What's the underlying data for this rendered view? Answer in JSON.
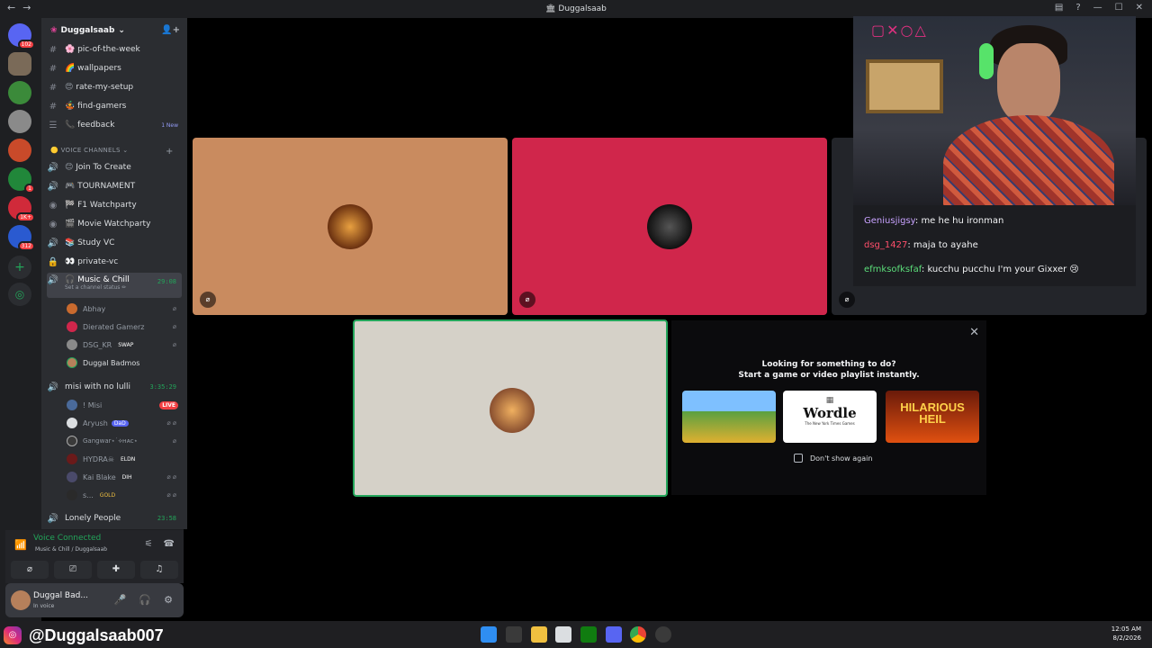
{
  "window": {
    "title": "Duggalsaab"
  },
  "servers": {
    "home_badge": "102",
    "badges": [
      "1",
      "1K+",
      "312"
    ]
  },
  "guild": {
    "name": "Duggalsaab"
  },
  "channels": [
    {
      "name": "pic-of-the-week",
      "emoji": "🌸"
    },
    {
      "name": "wallpapers",
      "emoji": "🌈"
    },
    {
      "name": "rate-my-setup",
      "emoji": "😍"
    },
    {
      "name": "find-gamers",
      "emoji": "🤹"
    },
    {
      "name": "feedback",
      "emoji": "📞",
      "badge": "1 New"
    }
  ],
  "voice_category": {
    "label": "VOICE CHANNELS"
  },
  "voice_channels": [
    {
      "name": "Join To Create",
      "emoji": "😊"
    },
    {
      "name": "TOURNAMENT",
      "emoji": "🎮"
    },
    {
      "name": "F1 Watchparty",
      "emoji": "🏁"
    },
    {
      "name": "Movie Watchparty",
      "emoji": "🎬"
    },
    {
      "name": "Study VC",
      "emoji": "📚"
    },
    {
      "name": "private-vc",
      "emoji": "👀"
    }
  ],
  "active_channel": {
    "name": "Music & Chill",
    "emoji": "🎧",
    "time": "29:08",
    "status": "Set a channel status ✏"
  },
  "active_members": [
    {
      "name": "Abhay"
    },
    {
      "name": "Dierated Gamerz"
    },
    {
      "name": "DSG_KR",
      "tag": "SWAP"
    },
    {
      "name": "Duggal Badmos"
    }
  ],
  "other_channel": {
    "name": "misi with no lulli",
    "time": "3:35:29"
  },
  "other_members": [
    {
      "name": "! Misi",
      "live": "LIVE"
    },
    {
      "name": "Aryush",
      "tag": "DaD"
    },
    {
      "name": "Gangwar⋆˙⟡ʜᴀᴄ⋆"
    },
    {
      "name": "HYDRA☠",
      "tag": "ELDN"
    },
    {
      "name": "Kai Blake",
      "tag": "DIH"
    },
    {
      "name": "s...",
      "tag": "GOLD"
    }
  ],
  "next_channel": {
    "name": "Lonely People",
    "time": "23:58"
  },
  "voice_panel": {
    "status": "Voice Connected",
    "location": "Music & Chill / Duggalsaab"
  },
  "user_panel": {
    "name": "Duggal Bad...",
    "status": "In voice"
  },
  "chat": [
    {
      "user": "Geniusjigsy",
      "text": "me he hu ironman"
    },
    {
      "user": "dsg_1427",
      "text": "maja to ayahe"
    },
    {
      "user": "efmksofksfaf",
      "text": "kucchu pucchu I'm your Gixxer 😢"
    }
  ],
  "activity": {
    "line1": "Looking for something to do?",
    "line2": "Start a game or video playlist instantly.",
    "games": [
      "Wordle",
      "HILARIOUS HEIL"
    ],
    "wordle_sub": "The New York Times Games",
    "checkbox_label": "Don't show again"
  },
  "stream_overlay": {
    "handle": "@Duggalsaab007"
  },
  "clock": {
    "time": "12:05 AM",
    "date": "8/2/2026"
  },
  "colors": {
    "tile1": "#c98b5f",
    "tile2": "#d0264b",
    "tile3": "#23252a",
    "tile4": "#d5d1c8",
    "accent": "#23a55a"
  }
}
